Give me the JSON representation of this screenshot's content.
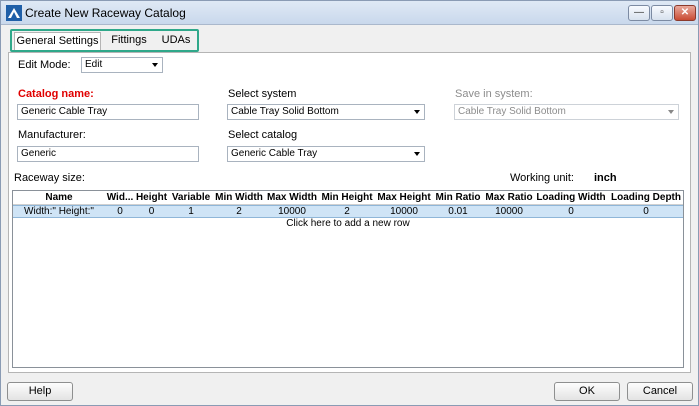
{
  "window": {
    "title": "Create New Raceway Catalog",
    "minimize_glyph": "—",
    "restore_glyph": "▫",
    "close_glyph": "✕"
  },
  "tabs": [
    {
      "label": "General Settings",
      "active": true
    },
    {
      "label": "Fittings",
      "active": false
    },
    {
      "label": "UDAs",
      "active": false
    }
  ],
  "edit_mode": {
    "label": "Edit Mode:",
    "value": "Edit"
  },
  "catalog_name": {
    "label": "Catalog name:",
    "value": "Generic Cable Tray"
  },
  "select_system": {
    "label": "Select system",
    "value": "Cable Tray Solid Bottom"
  },
  "save_in_system": {
    "label": "Save in system:",
    "value": "Cable Tray Solid Bottom",
    "enabled": false
  },
  "manufacturer": {
    "label": "Manufacturer:",
    "value": "Generic"
  },
  "select_catalog": {
    "label": "Select catalog",
    "value": "Generic Cable Tray"
  },
  "raceway_size_label": "Raceway size:",
  "working_unit": {
    "label": "Working unit:",
    "value": "inch"
  },
  "grid": {
    "columns": [
      "Name",
      "Wid...",
      "Height",
      "Variable",
      "Min Width",
      "Max Width",
      "Min Height",
      "Max Height",
      "Min Ratio",
      "Max Ratio",
      "Loading Width",
      "Loading Depth"
    ],
    "rows": [
      [
        "Width:\" Height:\"",
        "0",
        "0",
        "1",
        "2",
        "10000",
        "2",
        "10000",
        "0.01",
        "10000",
        "0",
        "0"
      ]
    ],
    "add_row_text": "Click here to add a new row"
  },
  "buttons": {
    "help": "Help",
    "ok": "OK",
    "cancel": "Cancel"
  },
  "colors": {
    "required_label": "#e00000",
    "tab_highlight": "#2fa88a",
    "selected_row": "#cfe4f6"
  }
}
